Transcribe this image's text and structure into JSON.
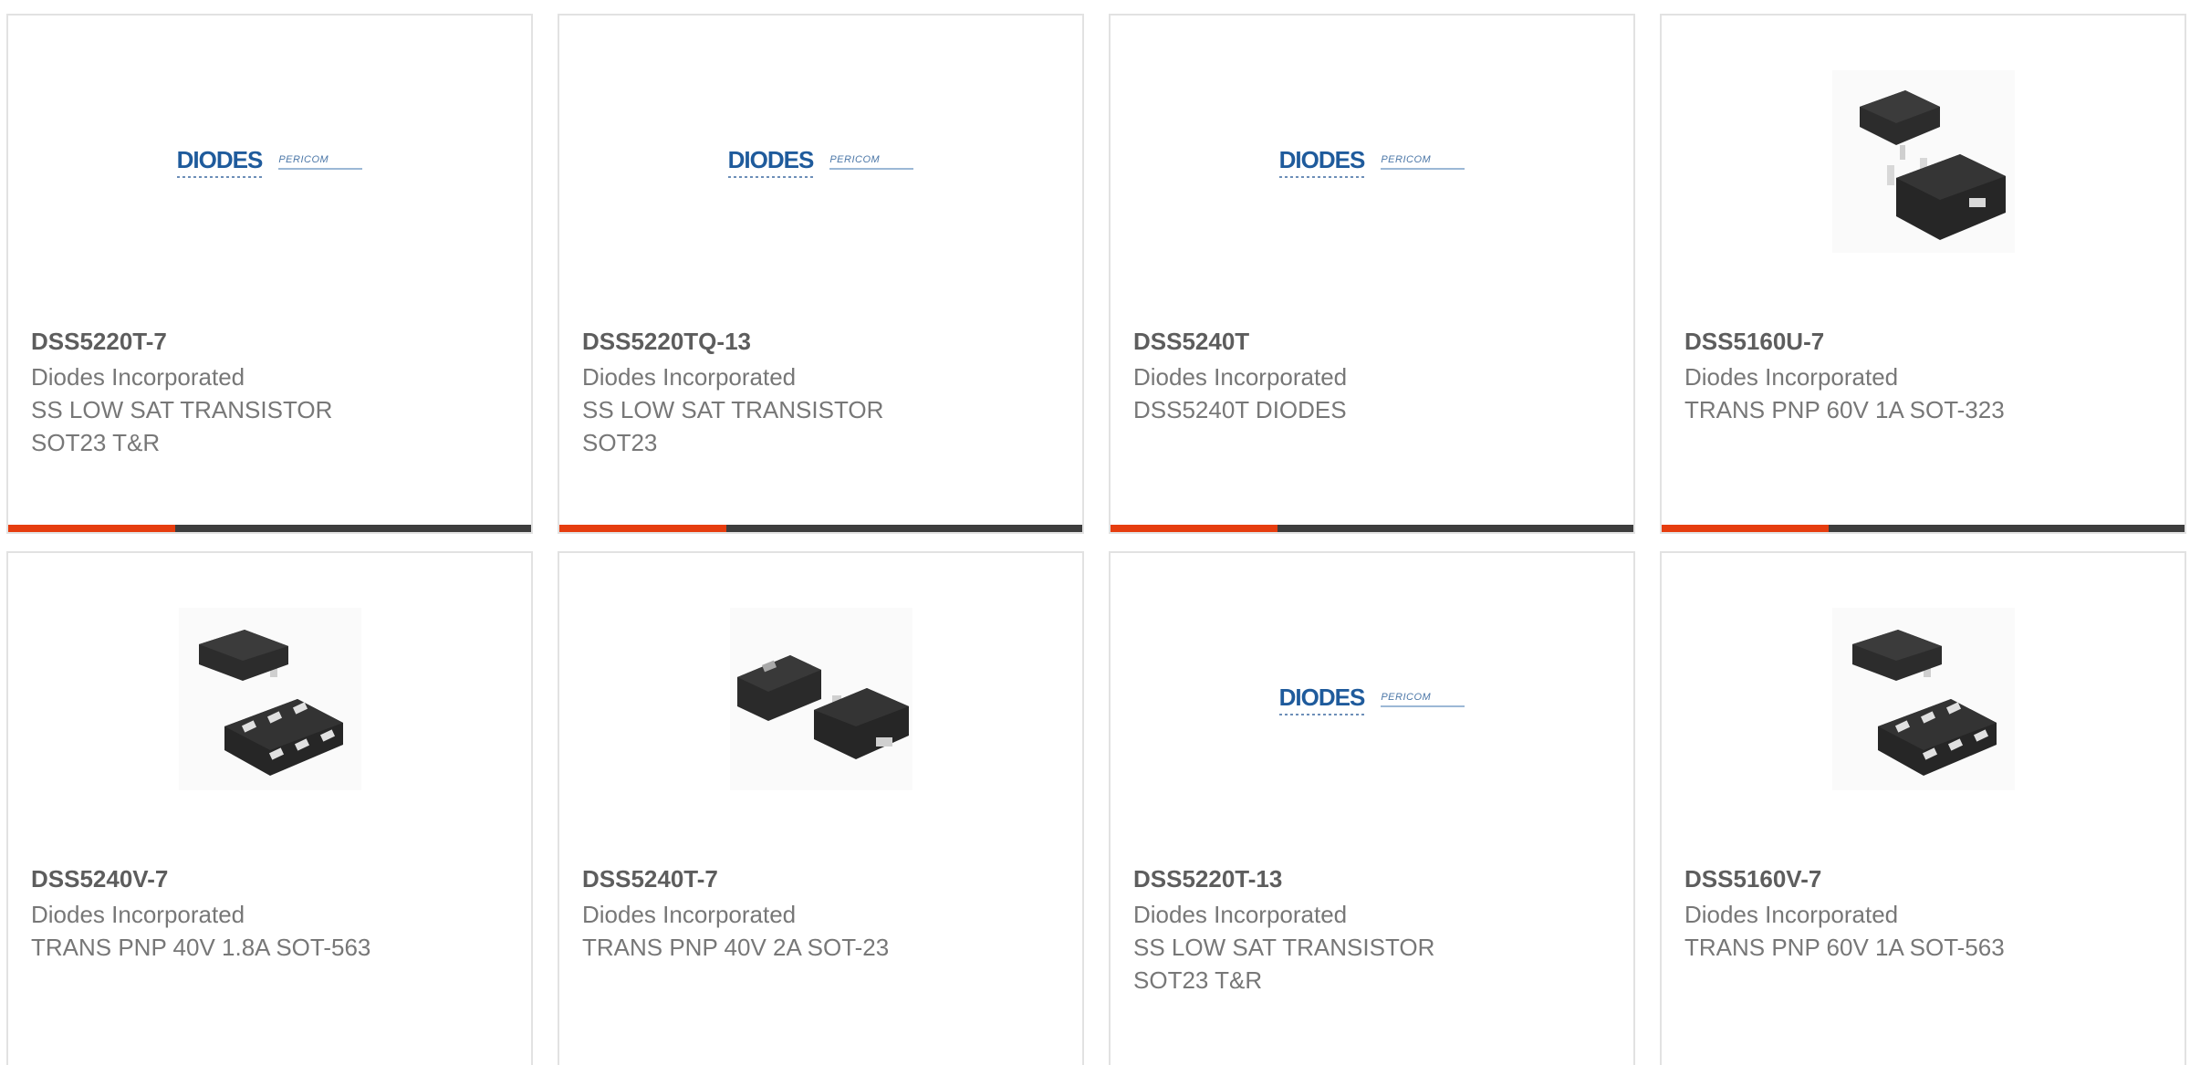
{
  "products": [
    {
      "part": "DSS5220T-7",
      "manufacturer": "Diodes Incorporated",
      "description": "SS LOW SAT TRANSISTOR\nSOT23 T&R",
      "image": "diodes-logo"
    },
    {
      "part": "DSS5220TQ-13",
      "manufacturer": "Diodes Incorporated",
      "description": "SS LOW SAT TRANSISTOR\nSOT23",
      "image": "diodes-logo"
    },
    {
      "part": "DSS5240T",
      "manufacturer": "Diodes Incorporated",
      "description": "DSS5240T DIODES",
      "image": "diodes-logo"
    },
    {
      "part": "DSS5160U-7",
      "manufacturer": "Diodes Incorporated",
      "description": "TRANS PNP 60V 1A SOT-323",
      "image": "sot323-package-photo"
    },
    {
      "part": "DSS5240V-7",
      "manufacturer": "Diodes Incorporated",
      "description": "TRANS PNP 40V 1.8A SOT-563",
      "image": "sot563-package-photo"
    },
    {
      "part": "DSS5240T-7",
      "manufacturer": "Diodes Incorporated",
      "description": "TRANS PNP 40V 2A SOT-23",
      "image": "sot23-package-photo"
    },
    {
      "part": "DSS5220T-13",
      "manufacturer": "Diodes Incorporated",
      "description": "SS LOW SAT TRANSISTOR\nSOT23 T&R",
      "image": "diodes-logo"
    },
    {
      "part": "DSS5160V-7",
      "manufacturer": "Diodes Incorporated",
      "description": "TRANS PNP 60V 1A SOT-563",
      "image": "sot563-package-photo"
    }
  ],
  "logo": {
    "brand": "DIODES",
    "partner": "PERICOM"
  },
  "colors": {
    "accent": "#e63d0f",
    "bar": "#3d3d3d",
    "brand_blue": "#1f5b9c"
  }
}
